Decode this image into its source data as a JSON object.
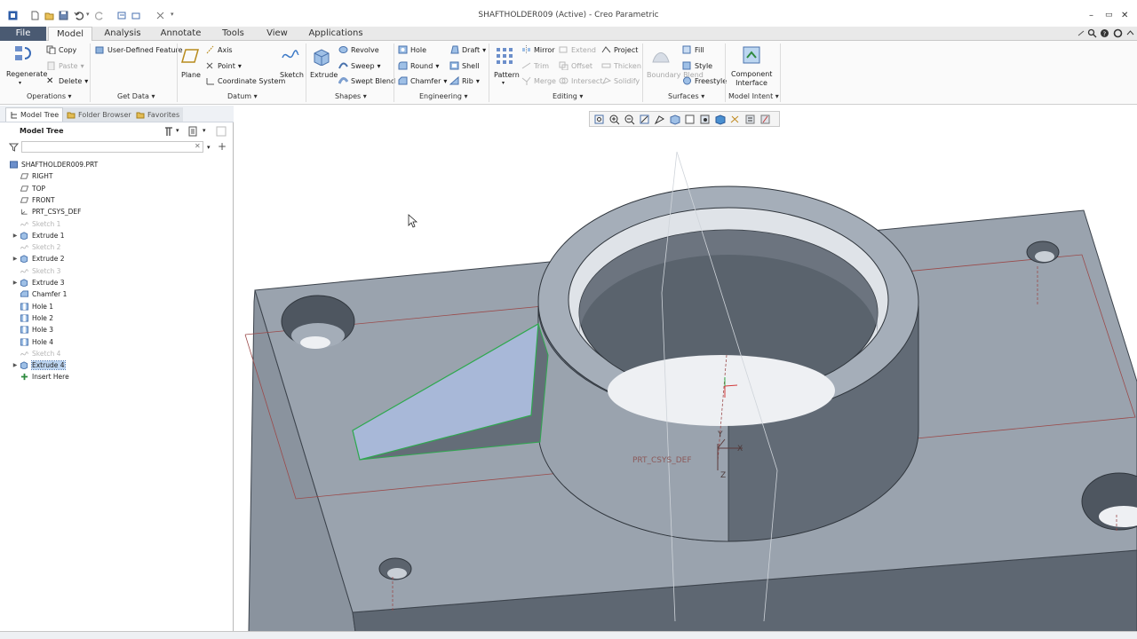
{
  "window": {
    "title": "SHAFTHOLDER009 (Active) - Creo Parametric"
  },
  "tabs": [
    {
      "label": "File"
    },
    {
      "label": "Model"
    },
    {
      "label": "Analysis"
    },
    {
      "label": "Annotate"
    },
    {
      "label": "Tools"
    },
    {
      "label": "View"
    },
    {
      "label": "Applications"
    }
  ],
  "ribbon": {
    "operations": {
      "regenerate": "Regenerate",
      "copy": "Copy",
      "paste": "Paste",
      "delete": "Delete",
      "group": "Operations"
    },
    "get_data": {
      "udf": "User-Defined Feature",
      "group": "Get Data"
    },
    "datum": {
      "plane": "Plane",
      "axis": "Axis",
      "point": "Point",
      "csys": "Coordinate System",
      "sketch": "Sketch",
      "group": "Datum"
    },
    "shapes": {
      "extrude": "Extrude",
      "revolve": "Revolve",
      "sweep": "Sweep",
      "swept_blend": "Swept Blend",
      "group": "Shapes"
    },
    "engineering": {
      "hole": "Hole",
      "round": "Round",
      "chamfer": "Chamfer",
      "draft": "Draft",
      "shell": "Shell",
      "rib": "Rib",
      "group": "Engineering"
    },
    "editing": {
      "pattern": "Pattern",
      "mirror": "Mirror",
      "trim": "Trim",
      "merge": "Merge",
      "extend": "Extend",
      "offset": "Offset",
      "intersect": "Intersect",
      "project": "Project",
      "thicken": "Thicken",
      "solidify": "Solidify",
      "group": "Editing"
    },
    "surfaces": {
      "boundary_blend": "Boundary Blend",
      "fill": "Fill",
      "style": "Style",
      "freestyle": "Freestyle",
      "group": "Surfaces"
    },
    "model_intent": {
      "component_interface": "Component Interface",
      "group": "Model Intent"
    }
  },
  "left_tabs": {
    "model_tree": "Model Tree",
    "folder_browser": "Folder Browser",
    "favorites": "Favorites"
  },
  "model_tree": {
    "title": "Model Tree",
    "items": [
      {
        "label": "SHAFTHOLDER009.PRT",
        "icon": "part-icon"
      },
      {
        "label": "RIGHT",
        "icon": "datum-plane-icon"
      },
      {
        "label": "TOP",
        "icon": "datum-plane-icon"
      },
      {
        "label": "FRONT",
        "icon": "datum-plane-icon"
      },
      {
        "label": "PRT_CSYS_DEF",
        "icon": "csys-icon"
      },
      {
        "label": "Sketch 1",
        "icon": "sketch-icon",
        "state": "dim"
      },
      {
        "label": "Extrude 1",
        "icon": "extrude-icon"
      },
      {
        "label": "Sketch 2",
        "icon": "sketch-icon",
        "state": "dim"
      },
      {
        "label": "Extrude 2",
        "icon": "extrude-icon"
      },
      {
        "label": "Sketch 3",
        "icon": "sketch-icon",
        "state": "dim"
      },
      {
        "label": "Extrude 3",
        "icon": "extrude-icon"
      },
      {
        "label": "Chamfer 1",
        "icon": "chamfer-icon"
      },
      {
        "label": "Hole 1",
        "icon": "hole-icon"
      },
      {
        "label": "Hole 2",
        "icon": "hole-icon"
      },
      {
        "label": "Hole 3",
        "icon": "hole-icon"
      },
      {
        "label": "Hole 4",
        "icon": "hole-icon"
      },
      {
        "label": "Sketch 4",
        "icon": "sketch-icon",
        "state": "dim"
      },
      {
        "label": "Extrude 4",
        "icon": "extrude-icon",
        "state": "selected"
      },
      {
        "label": "Insert Here",
        "icon": "insert-here-icon"
      }
    ]
  },
  "viewport": {
    "csys_label": "PRT_CSYS_DEF",
    "axis_labels": {
      "x": "X",
      "y": "Y",
      "z": "Z"
    }
  },
  "colors": {
    "file_tab": "#4a5a72",
    "model_face": "#9aa3ae",
    "model_dark": "#5f6873",
    "selection": "#2fa84f",
    "datum_line": "#a23b3b"
  }
}
